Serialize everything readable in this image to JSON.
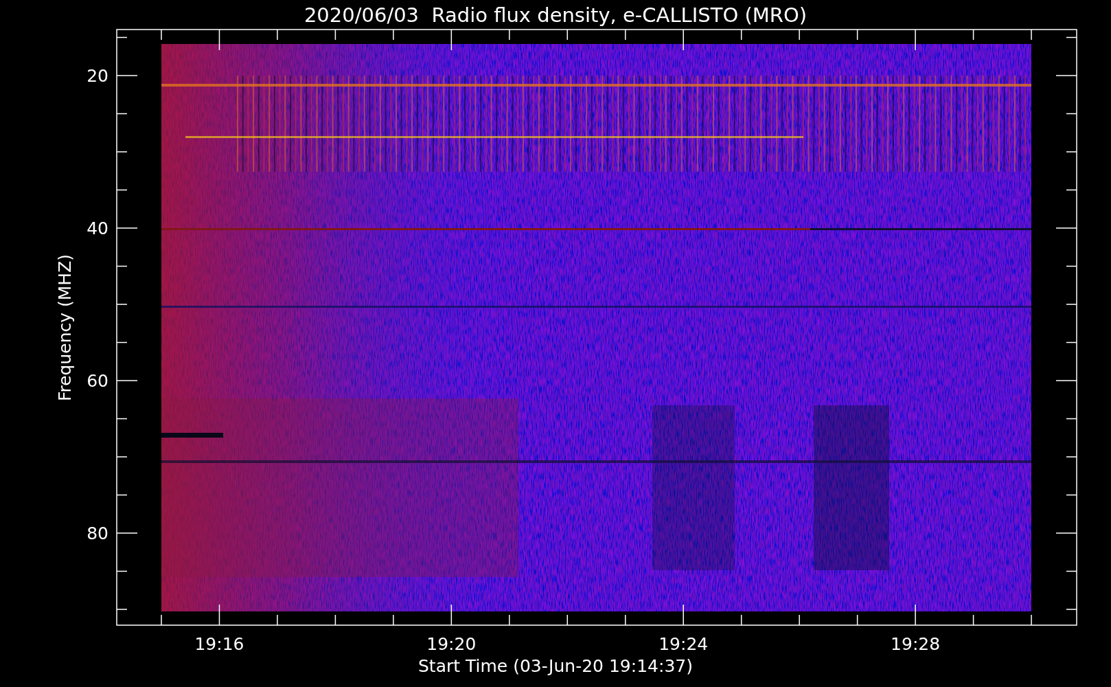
{
  "title": "2020/06/03  Radio flux density, e-CALLISTO (MRO)",
  "xlabel": "Start Time (03-Jun-20 19:14:37)",
  "ylabel": "Frequency (MHZ)",
  "yticks": [
    "20",
    "40",
    "60",
    "80"
  ],
  "xticks": [
    "19:16",
    "19:20",
    "19:24",
    "19:28"
  ]
}
